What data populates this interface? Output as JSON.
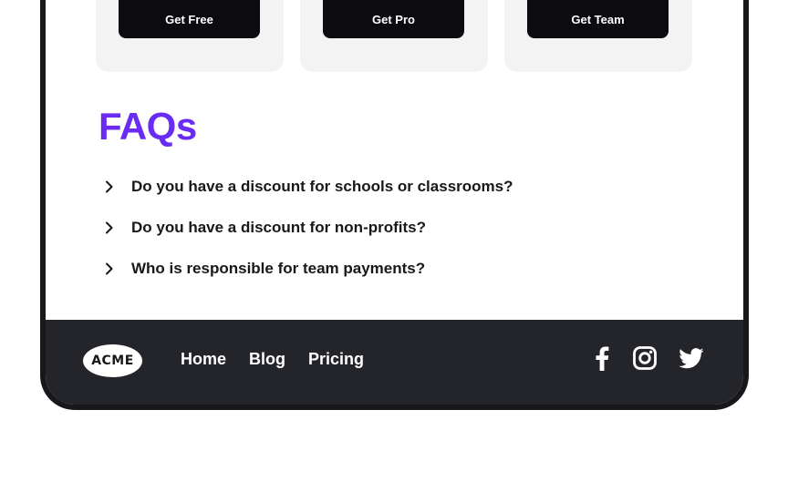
{
  "pricing": {
    "cards": [
      {
        "cta_label": "Get Free"
      },
      {
        "cta_label": "Get Pro"
      },
      {
        "cta_label": "Get Team"
      }
    ]
  },
  "faq": {
    "title": "FAQs",
    "items": [
      {
        "question": "Do you have a discount for schools or classrooms?",
        "icon": "chevron-right-icon"
      },
      {
        "question": "Do you have a discount for non-profits?",
        "icon": "chevron-right-icon"
      },
      {
        "question": "Who is responsible for team payments?",
        "icon": "chevron-right-icon"
      }
    ]
  },
  "footer": {
    "logo_text": "ACME",
    "nav": [
      "Home",
      "Blog",
      "Pricing"
    ],
    "social": [
      "facebook-icon",
      "instagram-icon",
      "twitter-icon"
    ]
  },
  "colors": {
    "accent": "#6a2bf5",
    "footer_bg": "#24252b",
    "button_bg": "#0b0b10",
    "card_bg": "#f3f3f4"
  }
}
